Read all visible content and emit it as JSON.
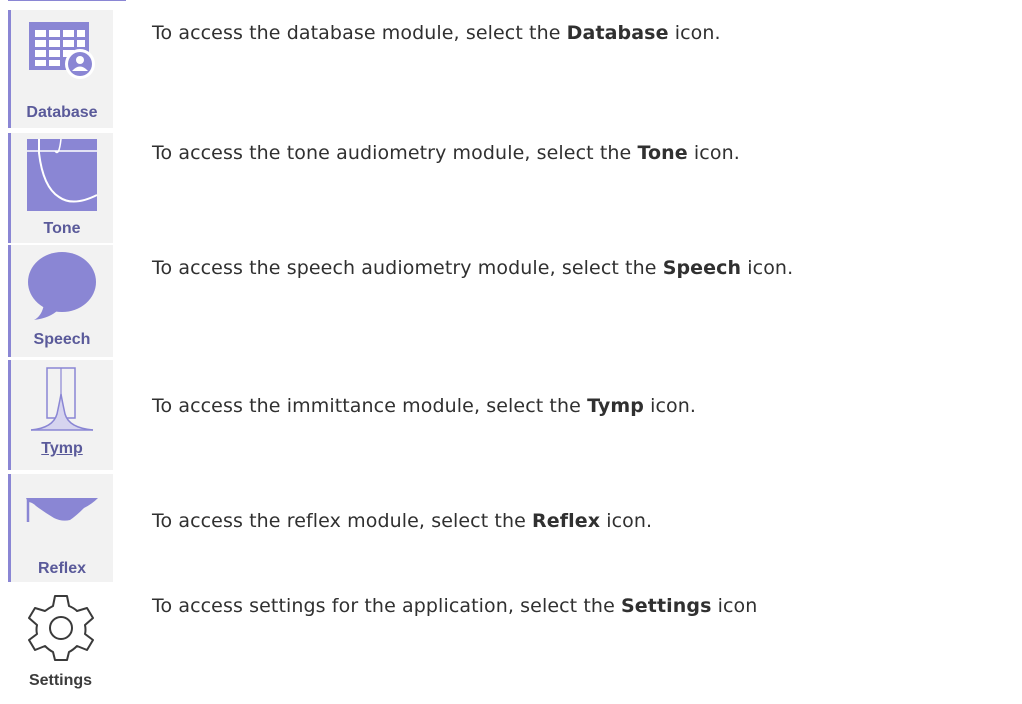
{
  "modules": [
    {
      "id": "database",
      "icon": "database-icon",
      "label": "Database",
      "text_before": "To access the database module, select the ",
      "text_bold": "Database",
      "text_after": " icon."
    },
    {
      "id": "tone",
      "icon": "tone-icon",
      "label": "Tone",
      "text_before": "To access the tone audiometry module, select the ",
      "text_bold": "Tone",
      "text_after": " icon."
    },
    {
      "id": "speech",
      "icon": "speech-icon",
      "label": "Speech",
      "text_before": "To access the speech audiometry module, select the ",
      "text_bold": "Speech",
      "text_after": " icon."
    },
    {
      "id": "tymp",
      "icon": "tymp-icon",
      "label": "Tymp",
      "text_before": "To access the immittance module, select the ",
      "text_bold": "Tymp",
      "text_after": " icon."
    },
    {
      "id": "reflex",
      "icon": "reflex-icon",
      "label": "Reflex",
      "text_before": "To access the reflex module, select the ",
      "text_bold": "Reflex",
      "text_after": " icon."
    },
    {
      "id": "settings",
      "icon": "gear-icon",
      "label": "Settings",
      "text_before": "To access settings for the application, select the ",
      "text_bold": "Settings",
      "text_after": " icon"
    }
  ],
  "colors": {
    "accent": "#8a86d4",
    "icon_fill": "#8a86d4",
    "label": "#5a5a9a"
  }
}
